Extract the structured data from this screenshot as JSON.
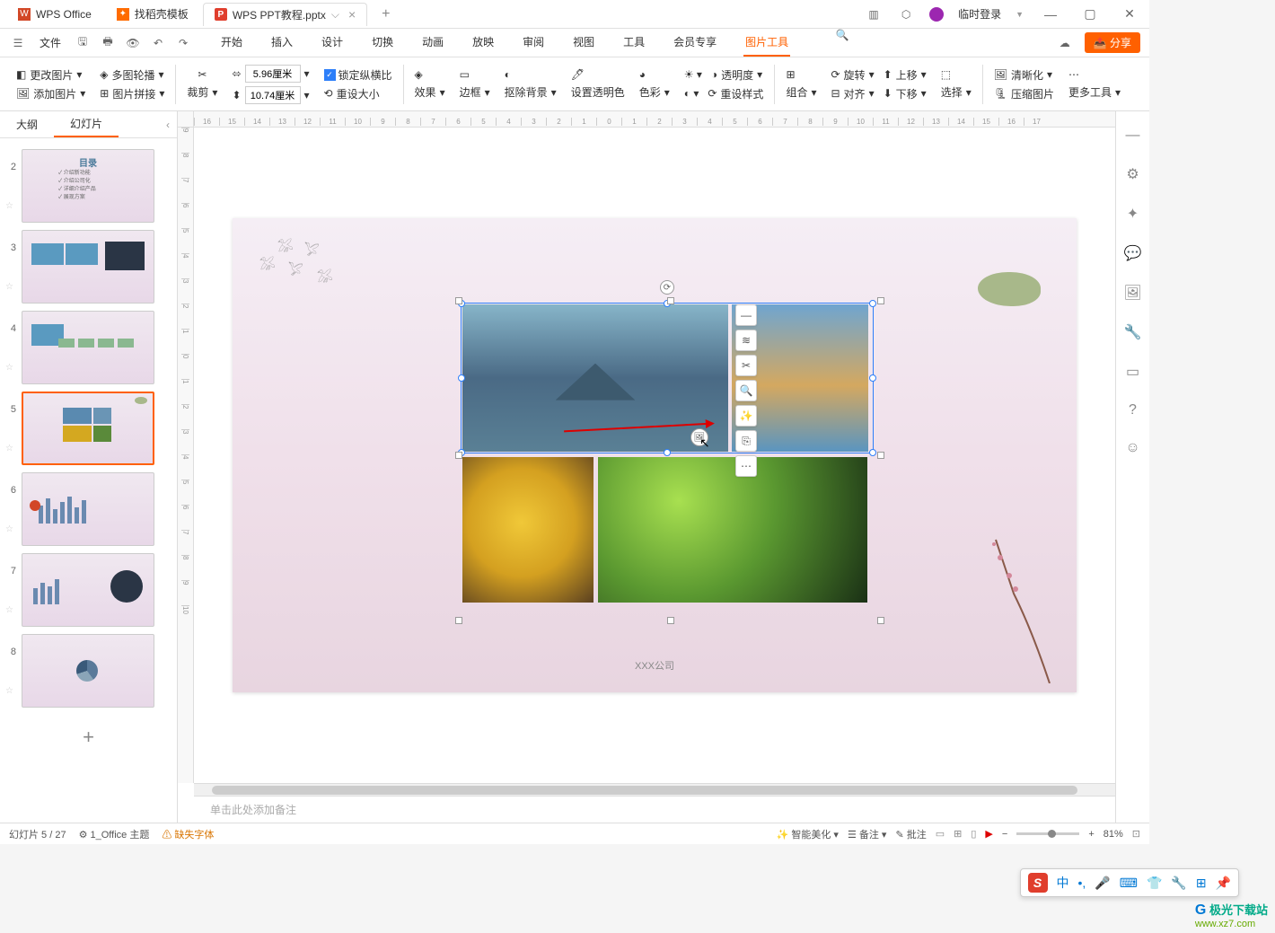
{
  "titlebar": {
    "tabs": [
      {
        "icon": "W",
        "label": "WPS Office"
      },
      {
        "icon": "🔥",
        "label": "找稻壳模板"
      },
      {
        "icon": "P",
        "label": "WPS PPT教程.pptx",
        "active": true
      }
    ],
    "user_label": "临时登录"
  },
  "menu": {
    "file": "文件",
    "tabs": [
      "开始",
      "插入",
      "设计",
      "切换",
      "动画",
      "放映",
      "审阅",
      "视图",
      "工具",
      "会员专享",
      "图片工具"
    ],
    "active_tab": "图片工具",
    "share": "分享"
  },
  "ribbon": {
    "change_img": "更改图片",
    "add_img": "添加图片",
    "multi_outline": "多图轮播",
    "img_stitch": "图片拼接",
    "crop": "裁剪",
    "width": "5.96厘米",
    "height": "10.74厘米",
    "lock_ratio": "锁定纵横比",
    "reset_size": "重设大小",
    "effect": "效果",
    "border": "边框",
    "remove_bg": "抠除背景",
    "set_transparent": "设置透明色",
    "color": "色彩",
    "transparency": "透明度",
    "reset_style": "重设样式",
    "group": "组合",
    "rotate": "旋转",
    "align": "对齐",
    "move_up": "上移",
    "move_down": "下移",
    "select": "选择",
    "sharpen": "清晰化",
    "compress": "压缩图片",
    "more_tools": "更多工具"
  },
  "panel": {
    "tab_outline": "大纲",
    "tab_slides": "幻灯片"
  },
  "thumbs": {
    "t2_title": "目录",
    "t2_items": [
      "✓ 介绍新功能",
      "✓ 介绍公司化",
      "✓ 详细介绍产品",
      "✓ 展现方案"
    ]
  },
  "slide": {
    "footer": "XXX公司"
  },
  "notes": {
    "placeholder": "单击此处添加备注"
  },
  "status": {
    "slide_info": "幻灯片 5 / 27",
    "theme": "1_Office 主题",
    "missing_font": "缺失字体",
    "smart_beautify": "智能美化",
    "notes": "备注",
    "comments": "批注",
    "zoom": "81%"
  },
  "ime": {
    "lang": "中"
  },
  "watermark": {
    "name": "极光下载站",
    "url": "www.xz7.com"
  }
}
